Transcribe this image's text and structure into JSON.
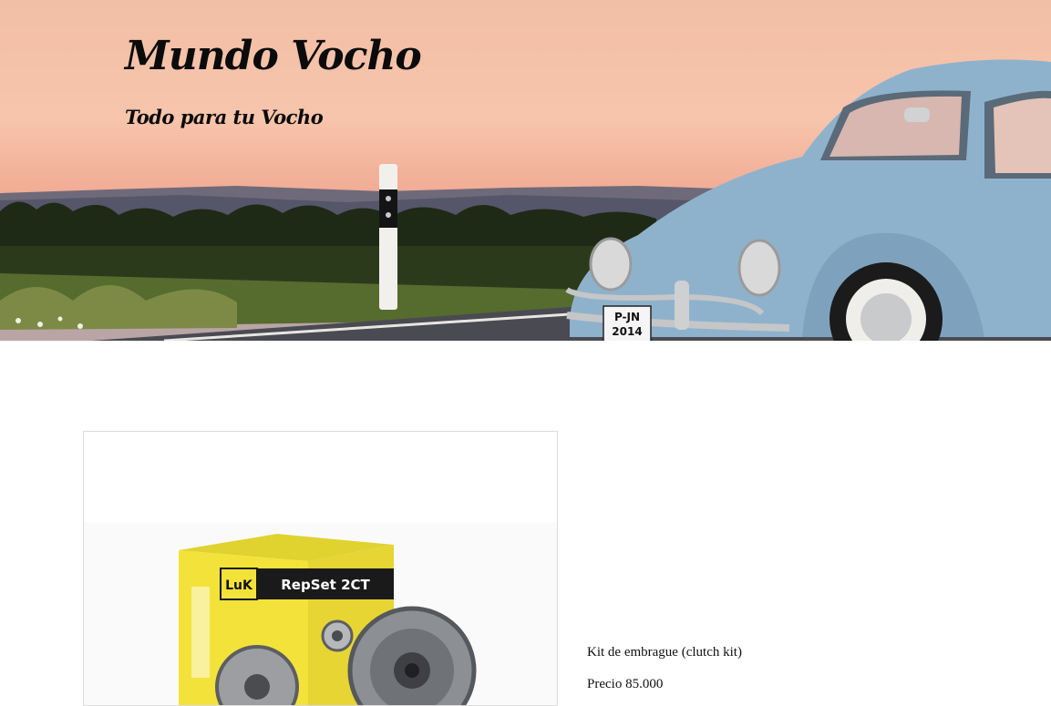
{
  "site": {
    "title": "Mundo Vocho",
    "tagline": "Todo para tu Vocho"
  },
  "hero": {
    "plate_line1": "P-JN",
    "plate_line2": "2014"
  },
  "product": {
    "name": "Kit de embrague (clutch kit)",
    "price": "Precio 85.000",
    "box_brand": "LuK",
    "box_text": "RepSet 2CT"
  },
  "colors": {
    "car_body": "#8fb2cc",
    "box_yellow": "#f3e23a"
  }
}
